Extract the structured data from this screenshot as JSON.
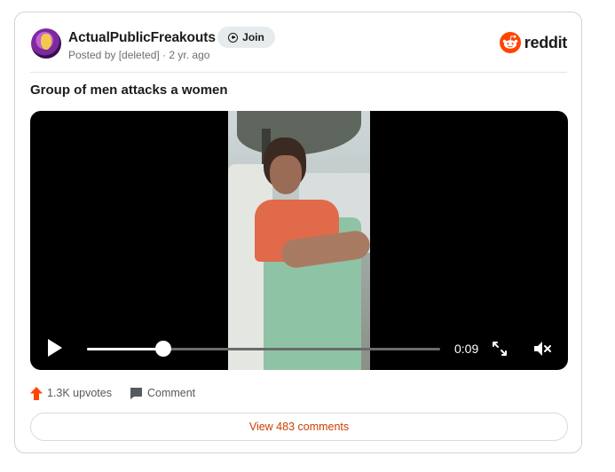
{
  "post": {
    "subreddit": "ActualPublicFreakouts",
    "join_label": "Join",
    "posted_by": "Posted by [deleted]",
    "age": "2 yr. ago",
    "meta_separator": " · ",
    "title": "Group of men attacks a women"
  },
  "brand": {
    "wordmark": "reddit",
    "color": "#ff4500"
  },
  "video": {
    "current_time": "0:09",
    "progress": 0.215,
    "state": "paused",
    "muted": true
  },
  "actions": {
    "upvotes": "1.3K upvotes",
    "comment": "Comment",
    "upvote_color": "#ff4500"
  },
  "footer": {
    "view_comments": "View 483 comments"
  },
  "icons": [
    "plus-circle-icon",
    "reddit-logo-icon",
    "play-icon",
    "fullscreen-icon",
    "mute-icon",
    "upvote-arrow-icon",
    "comment-icon"
  ]
}
